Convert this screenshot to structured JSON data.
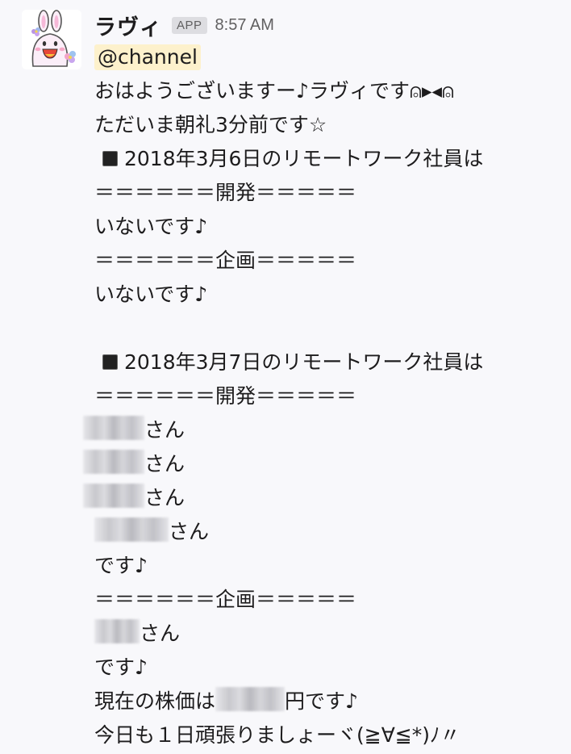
{
  "sender": {
    "name": "ラヴィ",
    "badge": "APP",
    "time": "8:57 AM"
  },
  "mention": "@channel",
  "lines": {
    "l1": "おはようございますー♪ラヴィです⍝▸◂⍝",
    "l2": "ただいま朝礼3分前です☆",
    "l3": "2018年3月6日のリモートワーク社員は",
    "l4": "＝＝＝＝＝＝開発＝＝＝＝＝",
    "l5": "いないです♪",
    "l6": "＝＝＝＝＝＝企画＝＝＝＝＝",
    "l7": "いないです♪",
    "l8": "2018年3月7日のリモートワーク社員は",
    "l9": "＝＝＝＝＝＝開発＝＝＝＝＝",
    "l10": "さん",
    "l11": "さん",
    "l12": "さん",
    "l13": "さん",
    "l14": "です♪",
    "l15": "＝＝＝＝＝＝企画＝＝＝＝＝",
    "l16": "さん",
    "l17": "です♪",
    "l18a": "現在の株価は",
    "l18b": "円です♪",
    "l19": "今日も１日頑張りましょーヾ(≧∀≦*)ﾉ〃"
  },
  "colors": {
    "background": "#f8f8fb",
    "mention_bg": "#fdf1cc",
    "badge_bg": "#dddde1",
    "muted_text": "#616061"
  },
  "icons": {
    "avatar": "bunny-bot-avatar",
    "bullet": "black-square-icon"
  }
}
